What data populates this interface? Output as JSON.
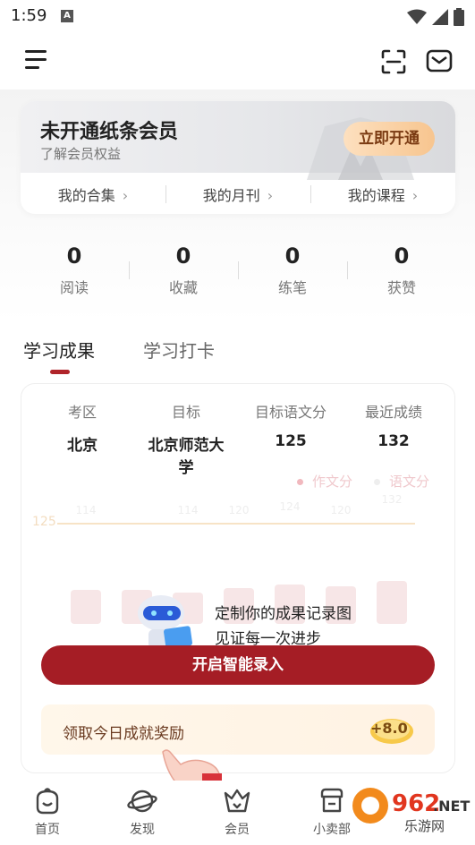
{
  "status_bar": {
    "time": "1:59",
    "notification_letter": "A"
  },
  "member_card": {
    "title": "未开通纸条会员",
    "subtitle": "了解会员权益",
    "open_button": "立即开通",
    "links": [
      {
        "label": "我的合集",
        "chevron": "›"
      },
      {
        "label": "我的月刊",
        "chevron": "›"
      },
      {
        "label": "我的课程",
        "chevron": "›"
      }
    ]
  },
  "stats": [
    {
      "value": "0",
      "label": "阅读"
    },
    {
      "value": "0",
      "label": "收藏"
    },
    {
      "value": "0",
      "label": "练笔"
    },
    {
      "value": "0",
      "label": "获赞"
    }
  ],
  "tabs": [
    {
      "label": "学习成果",
      "active": true
    },
    {
      "label": "学习打卡",
      "active": false
    }
  ],
  "results": {
    "info": [
      {
        "key": "考区",
        "value": "北京"
      },
      {
        "key": "目标",
        "value": "北京师范大学"
      },
      {
        "key": "目标语文分",
        "value": "125"
      },
      {
        "key": "最近成绩",
        "value": "132"
      }
    ],
    "chart_data": {
      "type": "bar",
      "legend": [
        "作文分",
        "语文分"
      ],
      "target_label": "125",
      "bar_labels": [
        "114",
        "",
        "114",
        "120",
        "124",
        "120",
        "132"
      ],
      "values": [
        114,
        111,
        114,
        120,
        124,
        120,
        132
      ],
      "colors": {
        "bar": "#f7e6e7",
        "target_line": "#f7e3c6",
        "legend_dot_1": "#f1b8be",
        "legend_dot_2": "#eeeeee"
      }
    },
    "promo": {
      "line1": "定制你的成果记录图",
      "line2": "见证每一次进步"
    },
    "primary_button": "开启智能录入",
    "reward": {
      "text": "领取今日成就奖励",
      "coin_value": "+8.0"
    }
  },
  "bottom_nav": [
    {
      "label": "首页",
      "icon": "home-face-icon"
    },
    {
      "label": "发现",
      "icon": "planet-icon"
    },
    {
      "label": "会员",
      "icon": "crown-icon"
    },
    {
      "label": "小卖部",
      "icon": "shop-icon"
    }
  ],
  "watermark": {
    "text": "962.NET",
    "sub": "乐游网"
  },
  "colors": {
    "accent": "#a51d25",
    "gold": "#f7c58f"
  }
}
